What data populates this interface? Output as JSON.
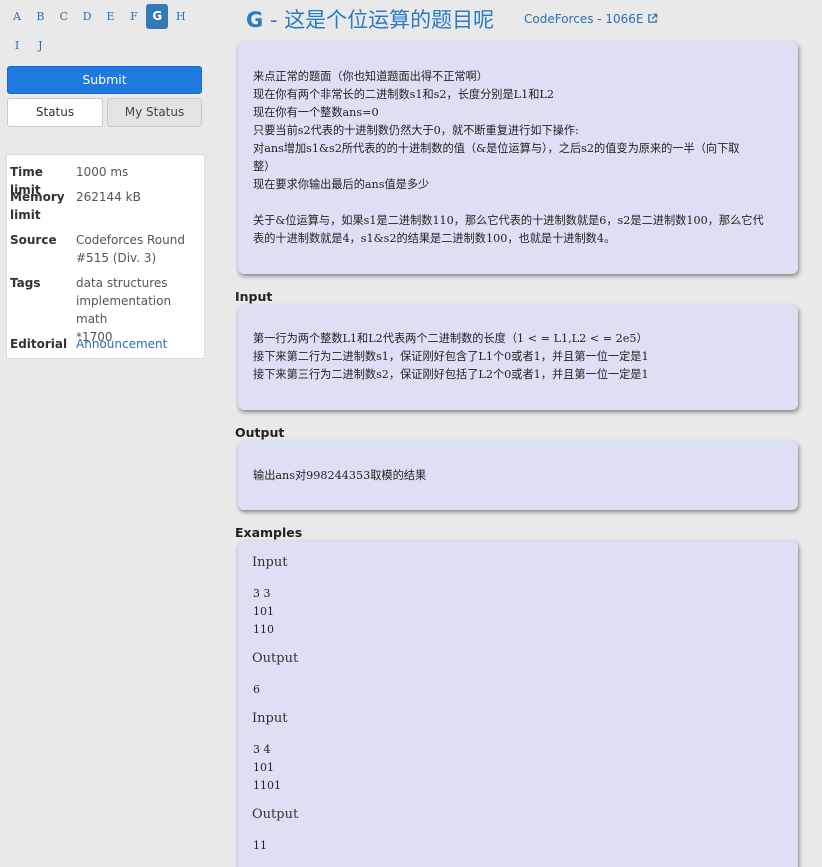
{
  "nav": {
    "letters": [
      "A",
      "B",
      "C",
      "D",
      "E",
      "F",
      "G",
      "H",
      "I",
      "J"
    ],
    "active": "G"
  },
  "actions": {
    "submit": "Submit",
    "status": "Status",
    "my_status": "My Status"
  },
  "info": {
    "time_limit_label": "Time limit",
    "time_limit": "1000 ms",
    "memory_label_1": "Memory",
    "memory_label_2": "limit",
    "memory": "262144 kB",
    "source_label": "Source",
    "source_1": "Codeforces Round",
    "source_2": "#515 (Div. 3)",
    "tags_label": "Tags",
    "tags_1": "data structures",
    "tags_2": "implementation math",
    "tags_3": "*1700",
    "editorial_label": "Editorial",
    "editorial": "Announcement"
  },
  "header": {
    "letter": "G",
    "dash": " - ",
    "title": "这是个位运算的题目呢",
    "source_link": "CodeForces - 1066E",
    "external_icon": "external-link-icon"
  },
  "statement": {
    "lines": [
      "来点正常的题面（你也知道题面出得不正常啊）",
      "现在你有两个非常长的二进制数s1和s2，长度分别是L1和L2",
      "现在你有一个整数ans=0",
      "只要当前s2代表的十进制数仍然大于0，就不断重复进行如下操作:",
      "对ans增加s1&s2所代表的的十进制数的值（&是位运算与），之后s2的值变为原来的一半（向下取",
      "整）",
      "现在要求你输出最后的ans值是多少",
      "",
      "关于&位运算与，如果s1是二进制数110，那么它代表的十进制数就是6，s2是二进制数100，那么它代",
      "表的十进制数就是4，s1&s2的结果是二进制数100，也就是十进制数4。"
    ]
  },
  "input_section": {
    "label": "Input",
    "lines": [
      "第一行为两个整数L1和L2代表两个二进制数的长度（1 < = L1,L2 < = 2e5）",
      "接下来第二行为二进制数s1，保证刚好包含了L1个0或者1，并且第一位一定是1",
      "接下来第三行为二进制数s2，保证刚好包括了L2个0或者1，并且第一位一定是1"
    ]
  },
  "output_section": {
    "label": "Output",
    "lines": [
      "输出ans对998244353取模的结果"
    ]
  },
  "examples": {
    "label": "Examples",
    "items": [
      {
        "input_label": "Input",
        "input": [
          "3 3",
          "101",
          "110"
        ],
        "output_label": "Output",
        "output": [
          "6"
        ]
      },
      {
        "input_label": "Input",
        "input": [
          "3 4",
          "101",
          "1101"
        ],
        "output_label": "Output",
        "output": [
          "11"
        ]
      }
    ]
  },
  "colors": {
    "accent": "#2a7bc2",
    "submit_button": "#1f7ae0",
    "box_background": "#dde0f5",
    "page_background": "#e9e9e9"
  }
}
